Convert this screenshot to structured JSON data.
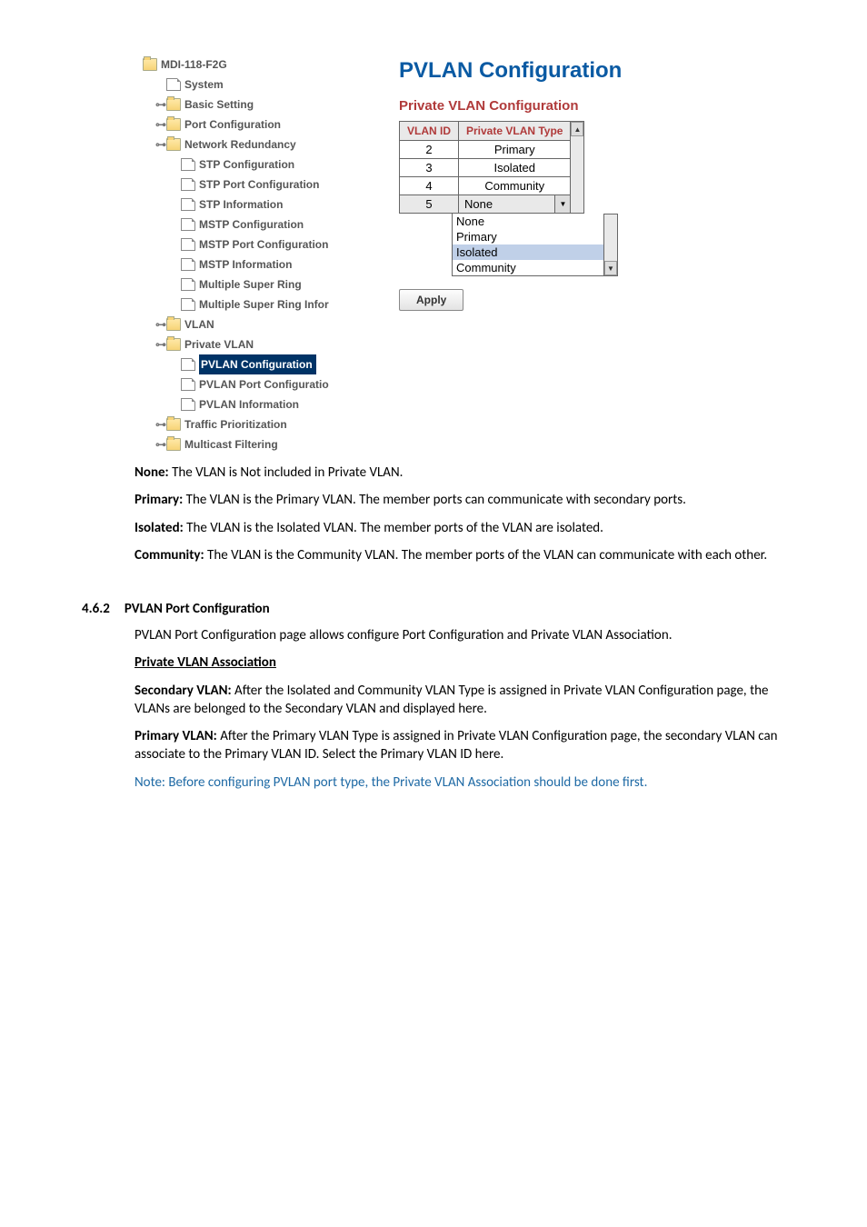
{
  "tree": {
    "root": "MDI-118-F2G",
    "items": [
      {
        "label": "System",
        "icon": "page"
      },
      {
        "label": "Basic Setting",
        "icon": "folder",
        "toggle": "o"
      },
      {
        "label": "Port Configuration",
        "icon": "folder",
        "toggle": "o"
      },
      {
        "label": "Network Redundancy",
        "icon": "folder",
        "toggle": "o",
        "children": [
          {
            "label": "STP Configuration"
          },
          {
            "label": "STP Port Configuration"
          },
          {
            "label": "STP Information"
          },
          {
            "label": "MSTP Configuration"
          },
          {
            "label": "MSTP Port Configuration"
          },
          {
            "label": "MSTP Information"
          },
          {
            "label": "Multiple Super Ring"
          },
          {
            "label": "Multiple Super Ring Infor"
          }
        ]
      },
      {
        "label": "VLAN",
        "icon": "folder",
        "toggle": "o"
      },
      {
        "label": "Private VLAN",
        "icon": "folder",
        "toggle": "o",
        "children": [
          {
            "label": "PVLAN Configuration",
            "selected": true
          },
          {
            "label": "PVLAN Port Configuratio"
          },
          {
            "label": "PVLAN Information"
          }
        ]
      },
      {
        "label": "Traffic Prioritization",
        "icon": "folder",
        "toggle": "o"
      },
      {
        "label": "Multicast Filtering",
        "icon": "folder",
        "toggle": "o"
      }
    ]
  },
  "config": {
    "title": "PVLAN Configuration",
    "subtitle": "Private VLAN Configuration",
    "headers": {
      "col1": "VLAN ID",
      "col2": "Private VLAN Type"
    },
    "rows": [
      {
        "id": "2",
        "type": "Primary"
      },
      {
        "id": "3",
        "type": "Isolated"
      },
      {
        "id": "4",
        "type": "Community"
      }
    ],
    "select_row": {
      "id": "5",
      "value": "None"
    },
    "options": [
      "None",
      "Primary",
      "Isolated",
      "Community"
    ],
    "apply_label": "Apply"
  },
  "body": {
    "none_term": "None:",
    "none_text": " The VLAN is Not included in Private VLAN.",
    "primary_term": "Primary:",
    "primary_text": " The VLAN is the Primary VLAN. The member ports can communicate with secondary ports.",
    "isolated_term": "Isolated:",
    "isolated_text": " The VLAN is the Isolated VLAN. The member ports of the VLAN are isolated.",
    "community_term": "Community:",
    "community_text": " The VLAN is the Community VLAN. The member ports of the VLAN can communicate with each other.",
    "section_num": "4.6.2",
    "section_title": "PVLAN Port Configuration",
    "section_intro": "PVLAN Port Configuration page allows configure Port Configuration and Private VLAN Association.",
    "assoc_heading": "Private VLAN Association",
    "secondary_term": "Secondary VLAN:",
    "secondary_text": " After the Isolated and Community VLAN Type is assigned in Private VLAN Configuration page, the VLANs are belonged to the Secondary VLAN and displayed here.",
    "primary_vlan_term": "Primary VLAN:",
    "primary_vlan_text": " After the Primary VLAN Type is assigned in Private VLAN Configuration page, the secondary VLAN can associate to the Primary VLAN ID. Select the Primary VLAN ID here.",
    "note": "Note: Before configuring PVLAN port type, the Private VLAN Association should be done first."
  }
}
